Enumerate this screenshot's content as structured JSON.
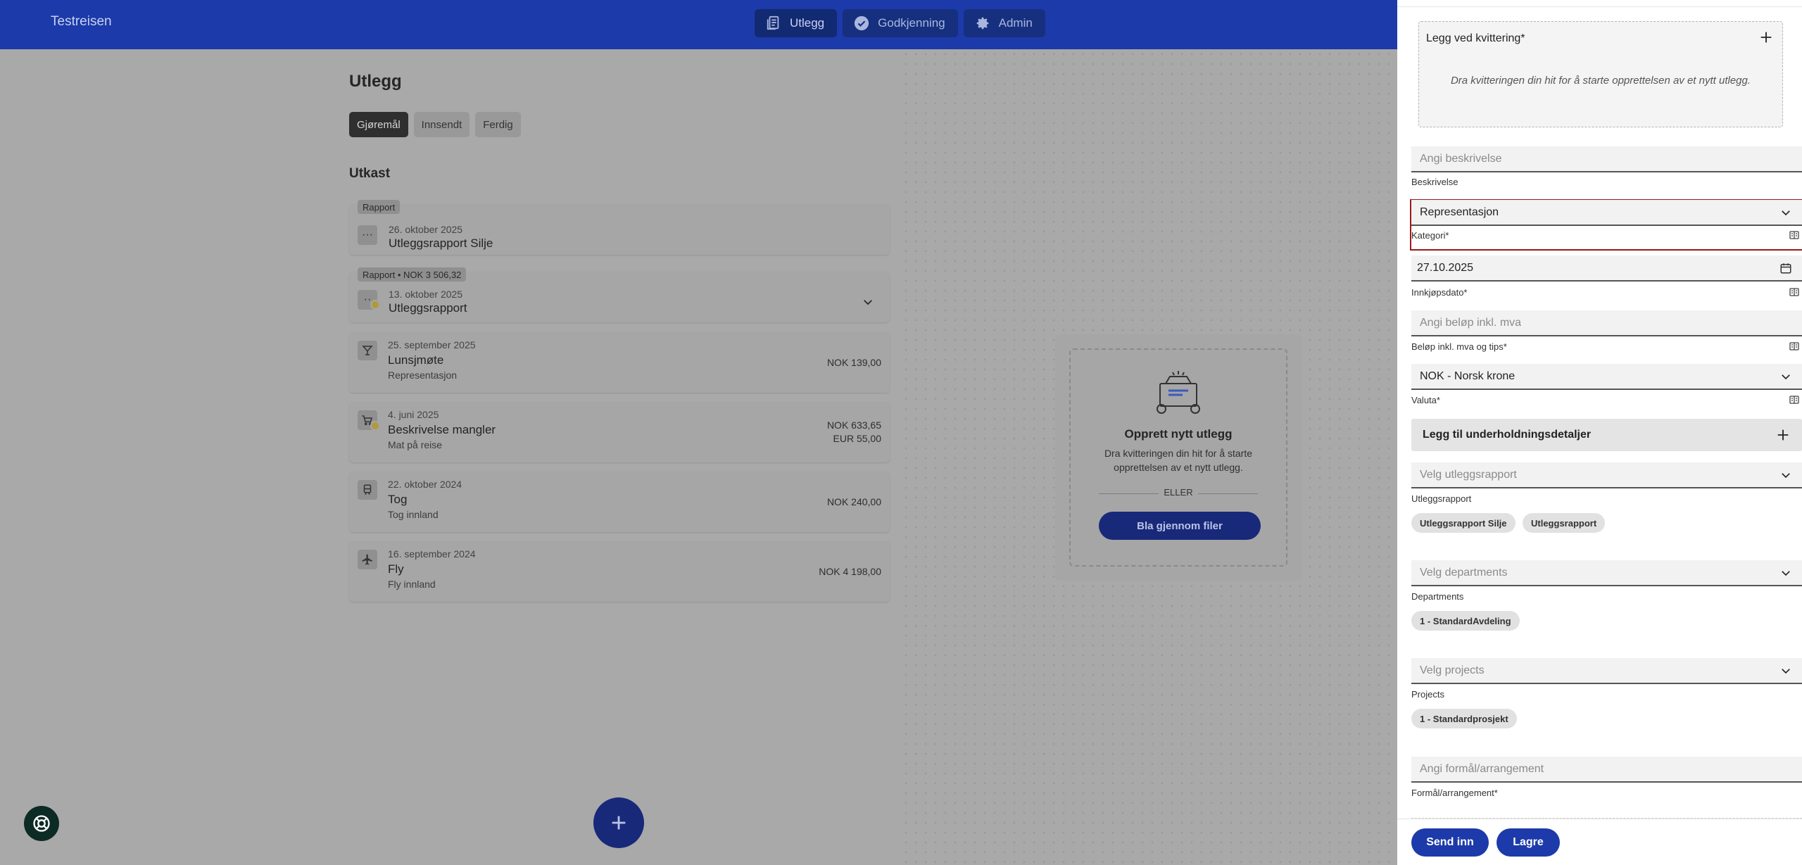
{
  "app": {
    "brand": "Testreisen"
  },
  "nav": {
    "tabs": [
      {
        "label": "Utlegg",
        "icon": "receipt-icon"
      },
      {
        "label": "Godkjenning",
        "icon": "check-circle-icon"
      },
      {
        "label": "Admin",
        "icon": "gear-icon"
      }
    ]
  },
  "main": {
    "title": "Utlegg",
    "filters": [
      "Gjøremål",
      "Innsendt",
      "Ferdig"
    ],
    "section": "Utkast",
    "items": [
      {
        "tag": "Rapport",
        "date": "26. oktober 2025",
        "title": "Utleggsrapport Silje",
        "icon": "ellipsis-icon"
      },
      {
        "tag": "Rapport • NOK 3 506,32",
        "date": "13. oktober 2025",
        "title": "Utleggsrapport",
        "icon": "ellipsis-icon"
      },
      {
        "date": "25. september 2025",
        "title": "Lunsjmøte",
        "sub": "Representasjon",
        "amount": "NOK 139,00",
        "icon": "cocktail-icon"
      },
      {
        "date": "4. juni 2025",
        "title": "Beskrivelse mangler",
        "sub": "Mat på reise",
        "amount": "NOK 633,65",
        "amount2": "EUR 55,00",
        "icon": "cart-icon"
      },
      {
        "date": "22. oktober 2024",
        "title": "Tog",
        "sub": "Tog innland",
        "amount": "NOK 240,00",
        "icon": "train-icon"
      },
      {
        "date": "16. september 2024",
        "title": "Fly",
        "sub": "Fly innland",
        "amount": "NOK 4 198,00",
        "icon": "plane-icon"
      }
    ],
    "dropzone": {
      "title": "Opprett nytt utlegg",
      "text": "Dra kvitteringen din hit for å starte opprettelsen av et nytt utlegg.",
      "or": "ELLER",
      "button": "Bla gjennom filer"
    }
  },
  "panel": {
    "receipt": {
      "label": "Legg ved kvittering*",
      "hint": "Dra kvitteringen din hit for å starte opprettelsen av et nytt utlegg."
    },
    "description": {
      "placeholder": "Angi beskrivelse",
      "label": "Beskrivelse"
    },
    "category": {
      "value": "Representasjon",
      "label": "Kategori*"
    },
    "date": {
      "value": "27.10.2025",
      "label": "Innkjøpsdato*"
    },
    "amount": {
      "placeholder": "Angi beløp inkl. mva",
      "label": "Beløp inkl. mva og tips*"
    },
    "currency": {
      "value": "NOK - Norsk krone",
      "label": "Valuta*"
    },
    "entertainment": {
      "label": "Legg til underholdningsdetaljer"
    },
    "report": {
      "placeholder": "Velg utleggsrapport",
      "label": "Utleggsrapport",
      "chips": [
        "Utleggsrapport Silje",
        "Utleggsrapport"
      ]
    },
    "departments": {
      "placeholder": "Velg departments",
      "label": "Departments",
      "chips": [
        "1 - StandardAvdeling"
      ]
    },
    "projects": {
      "placeholder": "Velg projects",
      "label": "Projects",
      "chips": [
        "1 - Standardprosjekt"
      ]
    },
    "purpose": {
      "placeholder": "Angi formål/arrangement",
      "label": "Formål/arrangement*"
    },
    "footer": {
      "submit": "Send inn",
      "save": "Lagre"
    }
  },
  "colors": {
    "brand": "#1c3aa9",
    "error": "#9b1a1a",
    "help": "#0c2b24"
  }
}
